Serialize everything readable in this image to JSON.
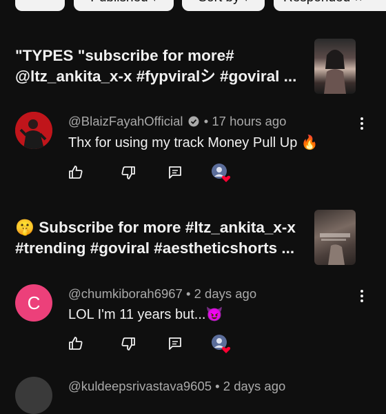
{
  "filters": {
    "chip_1_label": "",
    "chip_2_label": "Published",
    "chip_3_label": "Sort by",
    "chip_4_label": "Responded"
  },
  "videos": [
    {
      "title": "\"TYPES \"subscribe for more# @ltz_ankita_x-x #fypviralシ #goviral ...",
      "comment": {
        "author": "@BlaizFayahOfficial",
        "verified": true,
        "time": "• 17 hours ago",
        "text": "Thx for using my track Money Pull Up 🔥"
      }
    },
    {
      "title": "🤫 Subscribe for more #ltz_ankita_x-x #trending #goviral #aestheticshorts ...",
      "comment": {
        "author": "@chumkiborah6967",
        "verified": false,
        "time": "• 2 days ago",
        "text": "LOL I'm 11 years but...😈",
        "avatar_letter": "C"
      }
    },
    {
      "comment": {
        "author": "@kuldeepsrivastava9605",
        "time": "• 2 days ago"
      }
    }
  ],
  "colors": {
    "background": "#0f0f0f",
    "chip_bg": "#f2f2f2",
    "avatar_c_bg": "#ec407a",
    "heart": "#ff0033"
  }
}
